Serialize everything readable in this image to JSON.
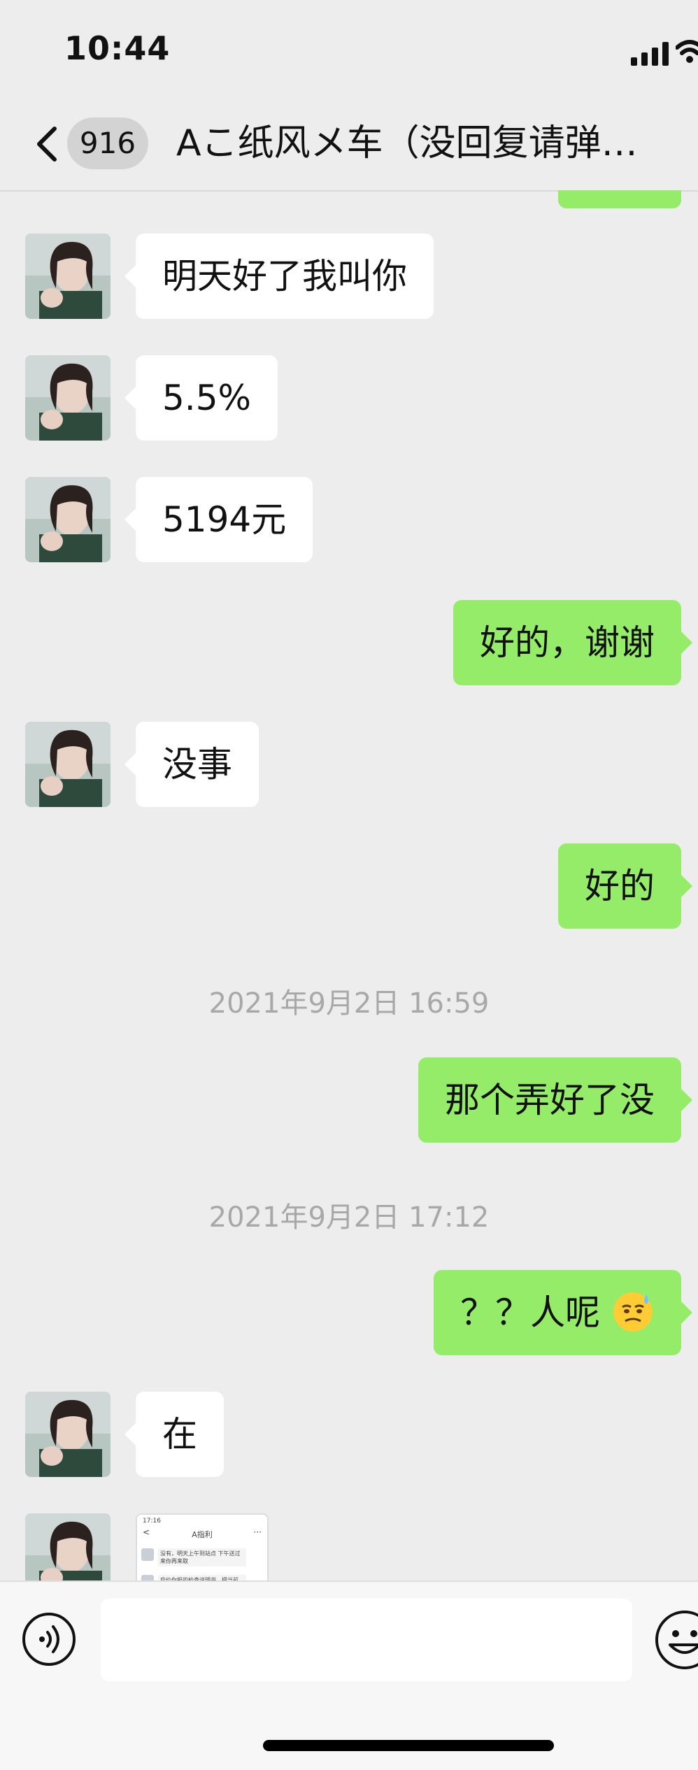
{
  "status_bar": {
    "time": "10:44"
  },
  "header": {
    "unread_count": "916",
    "title": "Aこ纸风メ车（没回复请弹…"
  },
  "messages": [
    {
      "side": "in",
      "text": "明天好了我叫你"
    },
    {
      "side": "in",
      "text": "5.5%"
    },
    {
      "side": "in",
      "text": "5194元"
    },
    {
      "side": "out",
      "text": "好的，谢谢"
    },
    {
      "side": "in",
      "text": "没事"
    },
    {
      "side": "out",
      "text": "好的"
    },
    {
      "type": "timestamp",
      "text": "2021年9月2日 16:59"
    },
    {
      "side": "out",
      "text": "那个弄好了没"
    },
    {
      "type": "timestamp",
      "text": "2021年9月2日 17:12"
    },
    {
      "side": "out",
      "text": "？？人呢",
      "emoji": "sweat-smile-emoji"
    },
    {
      "side": "in",
      "text": "在"
    },
    {
      "side": "in",
      "type": "image",
      "icon": "screenshot-thumbnail"
    }
  ],
  "thumbnail": {
    "time": "17:16",
    "title": "A指利",
    "back": "<",
    "more": "···",
    "row1": "没有，明天上午到站点  下午送过来你再来取",
    "row2": "应价你报的检查说明书，把当前"
  },
  "input_bar": {
    "value": "",
    "placeholder": ""
  },
  "colors": {
    "background": "#ededed",
    "outgoing_bubble": "#95ec69",
    "incoming_bubble": "#ffffff",
    "timestamp_text": "#a8a8a8"
  }
}
